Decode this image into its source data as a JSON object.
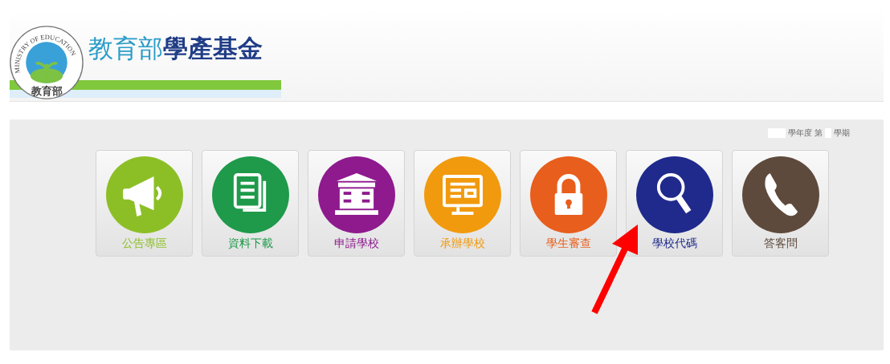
{
  "header": {
    "logo": {
      "ring_text": "MINISTRY OF EDUCATION",
      "seal_text": "教育部"
    },
    "title_prefix": "教育部",
    "title_main": "學產基金"
  },
  "term": {
    "year_suffix": "學年度 第",
    "term_suffix": "學期"
  },
  "tiles": [
    {
      "label": "公告專區",
      "kind": "megaphone",
      "color": "#8cbf26"
    },
    {
      "label": "資料下載",
      "kind": "documents",
      "color": "#1e9a4a"
    },
    {
      "label": "申請學校",
      "kind": "building",
      "color": "#8e1a8e"
    },
    {
      "label": "承辦學校",
      "kind": "monitor",
      "color": "#f19a0e"
    },
    {
      "label": "學生審查",
      "kind": "lock",
      "color": "#e85e1c"
    },
    {
      "label": "學校代碼",
      "kind": "search",
      "color": "#1f2a8c"
    },
    {
      "label": "答客問",
      "kind": "phone",
      "color": "#5e4a3c"
    }
  ]
}
